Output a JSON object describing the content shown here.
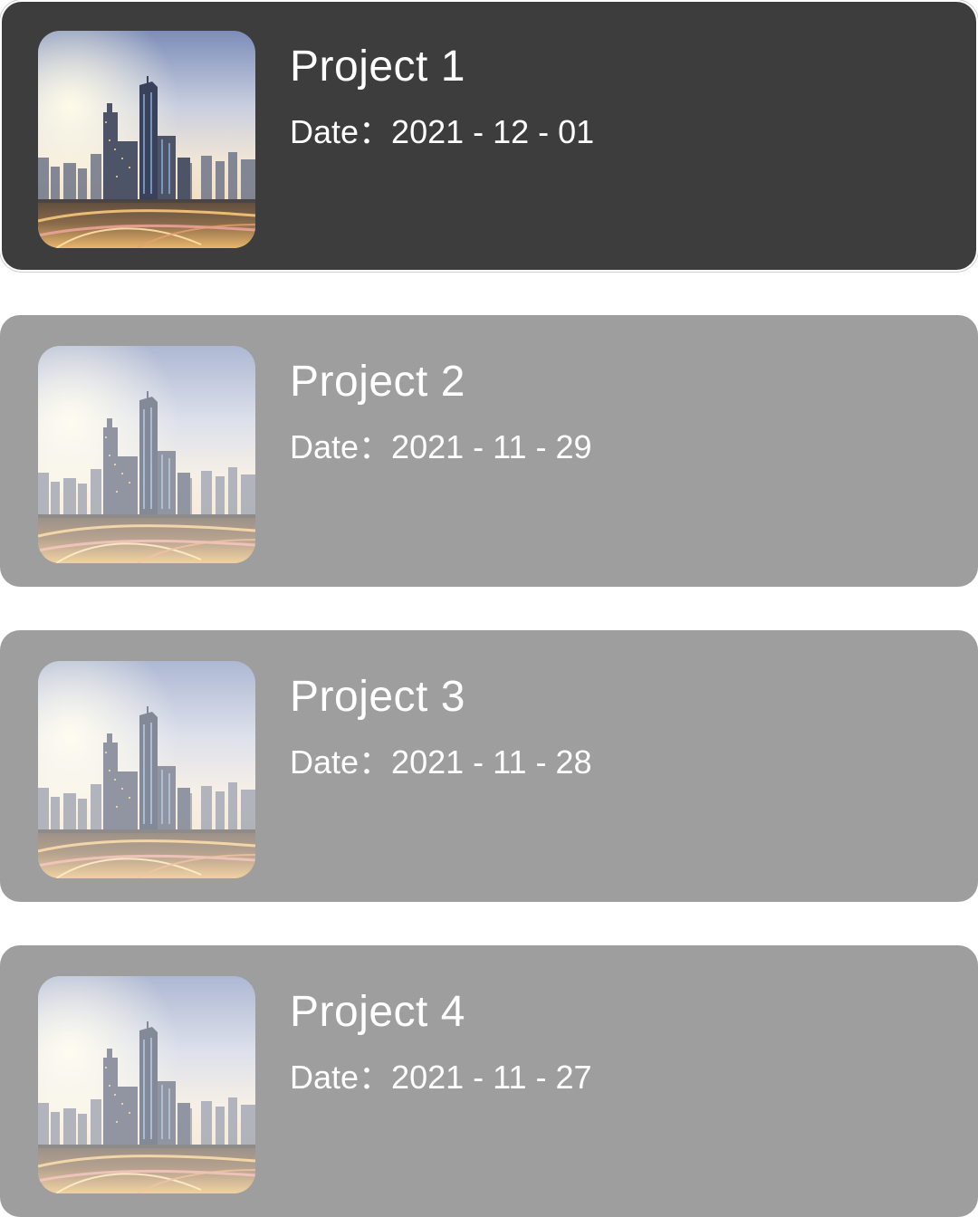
{
  "projects": [
    {
      "title": "Project 1",
      "date_label": "Date：2021 - 12 - 01",
      "selected": true
    },
    {
      "title": "Project 2",
      "date_label": "Date：2021 - 11 - 29",
      "selected": false
    },
    {
      "title": "Project 3",
      "date_label": "Date：2021 - 11 - 28",
      "selected": false
    },
    {
      "title": "Project 4",
      "date_label": "Date：2021 - 11 - 27",
      "selected": false
    }
  ],
  "thumbnail": {
    "subject": "city-skyline-photo"
  },
  "colors": {
    "selected_card": "#3d3d3d",
    "card": "#9e9e9e",
    "text": "#ffffff"
  }
}
